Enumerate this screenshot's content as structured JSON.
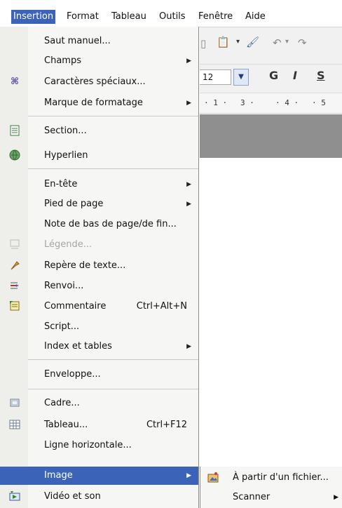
{
  "menubar": {
    "items": [
      "Insertion",
      "Format",
      "Tableau",
      "Outils",
      "Fenêtre",
      "Aide"
    ]
  },
  "toolbar": {
    "font_size": "12",
    "bold": "G",
    "italic": "I",
    "strike": "S",
    "ruler_marks": [
      "· 1 ·",
      "3 ·",
      "· 4 ·",
      "· 5"
    ]
  },
  "menu": {
    "items": [
      {
        "label": "Saut manuel...",
        "icon": "",
        "submenu": false
      },
      {
        "label": "Champs",
        "icon": "",
        "submenu": true
      },
      {
        "label": "Caractères spéciaux...",
        "icon": "omega-icon",
        "submenu": false
      },
      {
        "label": "Marque de formatage",
        "icon": "",
        "submenu": true
      },
      {
        "label": "Section...",
        "icon": "section-icon",
        "submenu": false
      },
      {
        "label": "Hyperlien",
        "icon": "hyperlink-globe-icon",
        "submenu": false
      },
      {
        "label": "En-tête",
        "icon": "",
        "submenu": true
      },
      {
        "label": "Pied de page",
        "icon": "",
        "submenu": true
      },
      {
        "label": "Note de bas de page/de fin...",
        "icon": "",
        "submenu": false
      },
      {
        "label": "Légende...",
        "icon": "caption-icon",
        "submenu": false,
        "disabled": true
      },
      {
        "label": "Repère de texte...",
        "icon": "bookmark-pin-icon",
        "submenu": false
      },
      {
        "label": "Renvoi...",
        "icon": "cross-reference-icon",
        "submenu": false
      },
      {
        "label": "Commentaire",
        "icon": "comment-icon",
        "shortcut": "Ctrl+Alt+N",
        "submenu": false
      },
      {
        "label": "Script...",
        "icon": "",
        "submenu": false
      },
      {
        "label": "Index et tables",
        "icon": "",
        "submenu": true
      },
      {
        "label": "Enveloppe...",
        "icon": "",
        "submenu": false
      },
      {
        "label": "Cadre...",
        "icon": "frame-icon",
        "submenu": false
      },
      {
        "label": "Tableau...",
        "icon": "table-icon",
        "shortcut": "Ctrl+F12",
        "submenu": false
      },
      {
        "label": "Ligne horizontale...",
        "icon": "",
        "submenu": false
      },
      {
        "label": "Image",
        "icon": "",
        "submenu": true,
        "highlighted": true
      },
      {
        "label": "Vidéo et son",
        "icon": "video-sound-icon",
        "submenu": false
      }
    ]
  },
  "submenu": {
    "items": [
      {
        "label": "À partir d'un fichier...",
        "icon": "image-from-file-icon",
        "submenu": false
      },
      {
        "label": "Scanner",
        "icon": "",
        "submenu": true
      }
    ]
  },
  "colors": {
    "highlight": "#3b63b7",
    "menu_bg": "#f6f6f4"
  }
}
